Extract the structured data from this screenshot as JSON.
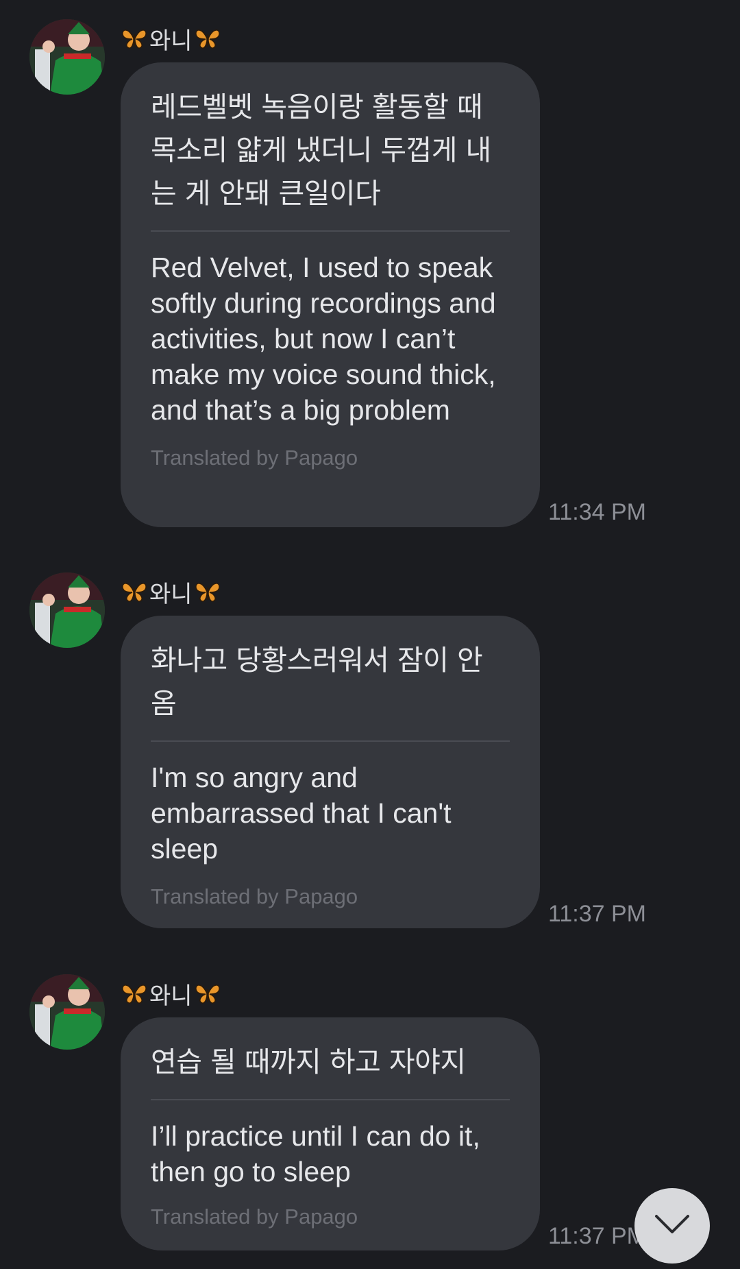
{
  "messages": [
    {
      "sender": "와니",
      "sender_decoration_icon": "butterfly-icon",
      "original": "레드벨벳 녹음이랑 활동할 때 목소리 얇게 냈더니 두껍게 내는 게 안돼 큰일이다",
      "translated": "Red Velvet, I used to speak softly during recordings and activities, but now I can’t make my voice sound thick, and that’s a big problem",
      "credit": "Translated by Papago",
      "time": "11:34 PM"
    },
    {
      "sender": "와니",
      "sender_decoration_icon": "butterfly-icon",
      "original": "화나고 당황스러워서 잠이 안 옴",
      "translated": "I'm so angry and embarrassed that I can't sleep",
      "credit": "Translated by Papago",
      "time": "11:37 PM"
    },
    {
      "sender": "와니",
      "sender_decoration_icon": "butterfly-icon",
      "original": "연습 될 때까지 하고 자야지",
      "translated": "I’ll practice until I can do it, then go to sleep",
      "credit": "Translated by Papago",
      "time": "11:37 PM"
    }
  ],
  "scroll_button": {
    "icon": "chevron-down-icon"
  },
  "colors": {
    "background": "#1b1c20",
    "bubble": "#35373d",
    "text": "#e6e7ea",
    "muted": "#6d6f76",
    "time": "#8d8f96",
    "butterfly": "#e9962a"
  }
}
